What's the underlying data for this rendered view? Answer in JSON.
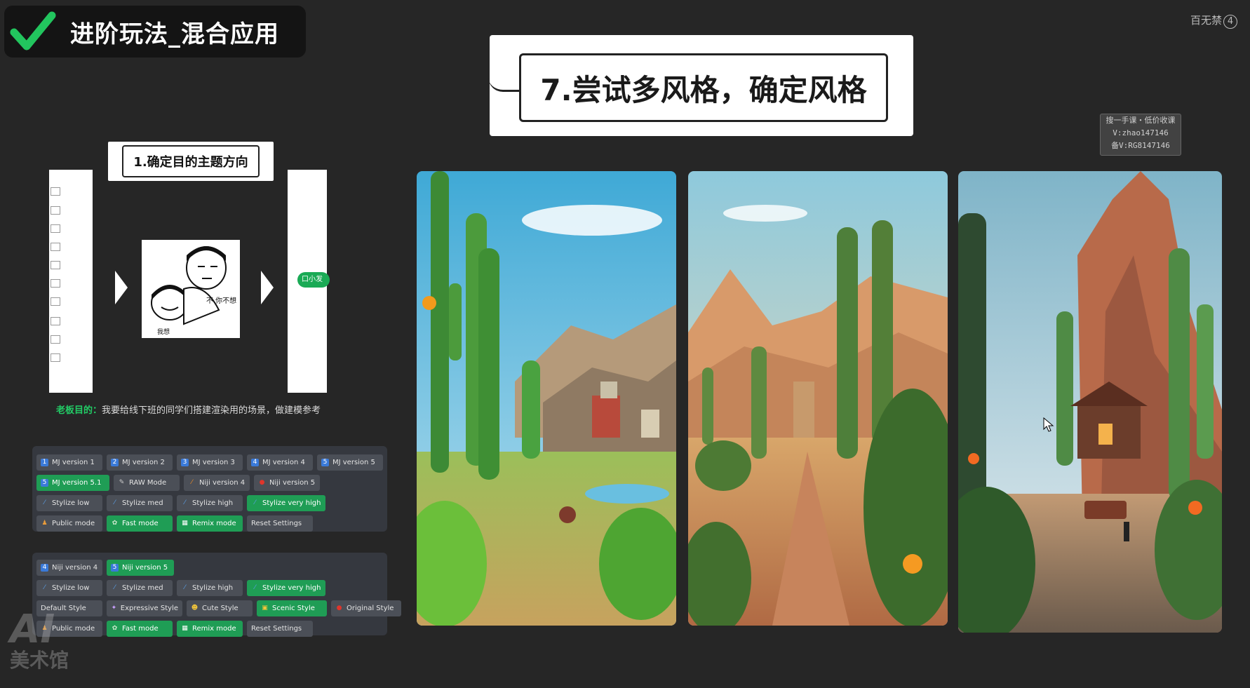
{
  "header": {
    "title": "进阶玩法_混合应用"
  },
  "top_right": {
    "brand_text": "百无禁",
    "brand_num": "4"
  },
  "watermark": {
    "lines": [
      "搜一手课・低价收课",
      "V:zhao147146",
      "备V:RG8147146"
    ]
  },
  "step": {
    "title": "7.尝试多风格，确定风格"
  },
  "mindmap": {
    "label": "1.确定目的主题方向",
    "right_pill": "口小发",
    "meme_text_1": "不 你不想",
    "meme_text_2": "我想",
    "caption_label": "老板目的：",
    "caption_text": "我要给线下班的同学们搭建渲染用的场景，做建模参考"
  },
  "panel1": {
    "rows": [
      [
        {
          "label": "MJ version 1",
          "icon": "1",
          "on": false
        },
        {
          "label": "MJ version 2",
          "icon": "2",
          "on": false
        },
        {
          "label": "MJ version 3",
          "icon": "3",
          "on": false
        },
        {
          "label": "MJ version 4",
          "icon": "4",
          "on": false
        },
        {
          "label": "MJ version 5",
          "icon": "5",
          "on": false
        }
      ],
      [
        {
          "label": "MJ version 5.1",
          "icon": "5",
          "on": true
        },
        {
          "label": "RAW Mode",
          "icon": "tool",
          "on": false
        },
        {
          "label": "Niji version 4",
          "icon": "brush",
          "on": false
        },
        {
          "label": "Niji version 5",
          "icon": "red",
          "on": false
        }
      ],
      [
        {
          "label": "Stylize low",
          "icon": "wand",
          "on": false
        },
        {
          "label": "Stylize med",
          "icon": "wand",
          "on": false
        },
        {
          "label": "Stylize high",
          "icon": "wand",
          "on": false
        },
        {
          "label": "Stylize very high",
          "icon": "wand",
          "on": true
        }
      ],
      [
        {
          "label": "Public mode",
          "icon": "person",
          "on": false
        },
        {
          "label": "Fast mode",
          "icon": "rabbit",
          "on": true
        },
        {
          "label": "Remix mode",
          "icon": "grid",
          "on": true
        },
        {
          "label": "Reset Settings",
          "icon": "",
          "on": false
        }
      ]
    ]
  },
  "panel2": {
    "rows": [
      [
        {
          "label": "Niji version 4",
          "icon": "4",
          "on": false
        },
        {
          "label": "Niji version 5",
          "icon": "5",
          "on": true
        }
      ],
      [
        {
          "label": "Stylize low",
          "icon": "wand",
          "on": false
        },
        {
          "label": "Stylize med",
          "icon": "wand",
          "on": false
        },
        {
          "label": "Stylize high",
          "icon": "wand",
          "on": false
        },
        {
          "label": "Stylize very high",
          "icon": "wand",
          "on": true
        }
      ],
      [
        {
          "label": "Default Style",
          "icon": "",
          "on": false
        },
        {
          "label": "Expressive Style",
          "icon": "palette",
          "on": false
        },
        {
          "label": "Cute Style",
          "icon": "smile",
          "on": false
        },
        {
          "label": "Scenic Style",
          "icon": "photo",
          "on": true
        },
        {
          "label": "Original Style",
          "icon": "red",
          "on": false
        }
      ],
      [
        {
          "label": "Public mode",
          "icon": "person",
          "on": false
        },
        {
          "label": "Fast mode",
          "icon": "rabbit",
          "on": true
        },
        {
          "label": "Remix mode",
          "icon": "grid",
          "on": true
        },
        {
          "label": "Reset Settings",
          "icon": "",
          "on": false
        }
      ]
    ]
  },
  "logo": {
    "text_top": "AI",
    "text_bottom": "美术馆"
  },
  "colors": {
    "background": "#262626",
    "accent_green": "#1f9d55",
    "check_green": "#22c55e"
  }
}
